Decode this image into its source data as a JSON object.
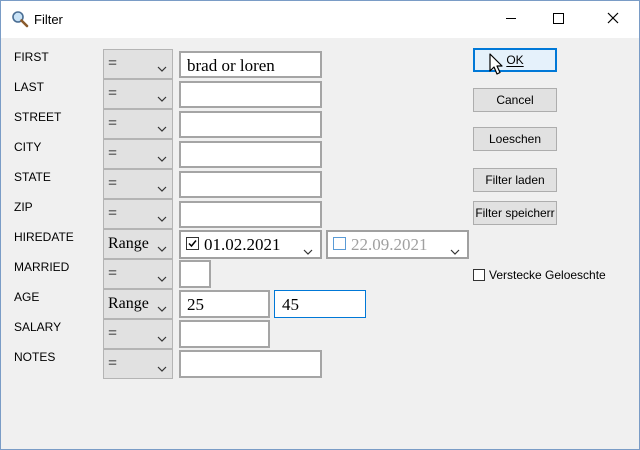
{
  "window": {
    "title": "Filter",
    "icons": {
      "app": "magnifier-icon",
      "minimize": "minimize-icon",
      "maximize": "maximize-icon",
      "close": "close-icon"
    }
  },
  "fields": [
    {
      "label": "FIRST",
      "operator": "=",
      "value": "brad or loren"
    },
    {
      "label": "LAST",
      "operator": "=",
      "value": ""
    },
    {
      "label": "STREET",
      "operator": "=",
      "value": ""
    },
    {
      "label": "CITY",
      "operator": "=",
      "value": ""
    },
    {
      "label": "STATE",
      "operator": "=",
      "value": ""
    },
    {
      "label": "ZIP",
      "operator": "=",
      "value": ""
    },
    {
      "label": "HIREDATE",
      "operator": "Range",
      "from": "01.02.2021",
      "from_checked": true,
      "to": "22.09.2021",
      "to_checked": false
    },
    {
      "label": "MARRIED",
      "operator": "=",
      "value": ""
    },
    {
      "label": "AGE",
      "operator": "Range",
      "from": "25",
      "to": "45"
    },
    {
      "label": "SALARY",
      "operator": "=",
      "value": ""
    },
    {
      "label": "NOTES",
      "operator": "=",
      "value": ""
    }
  ],
  "buttons": {
    "ok": "OK",
    "cancel": "Cancel",
    "loeschen": "Loeschen",
    "filter_laden": "Filter laden",
    "filter_speichern": "Filter speicherr"
  },
  "checkbox": {
    "label": "Verstecke Geloeschte",
    "checked": false
  },
  "colors": {
    "accent": "#0078d7",
    "date_disabled_text": "#a0a0a0"
  }
}
